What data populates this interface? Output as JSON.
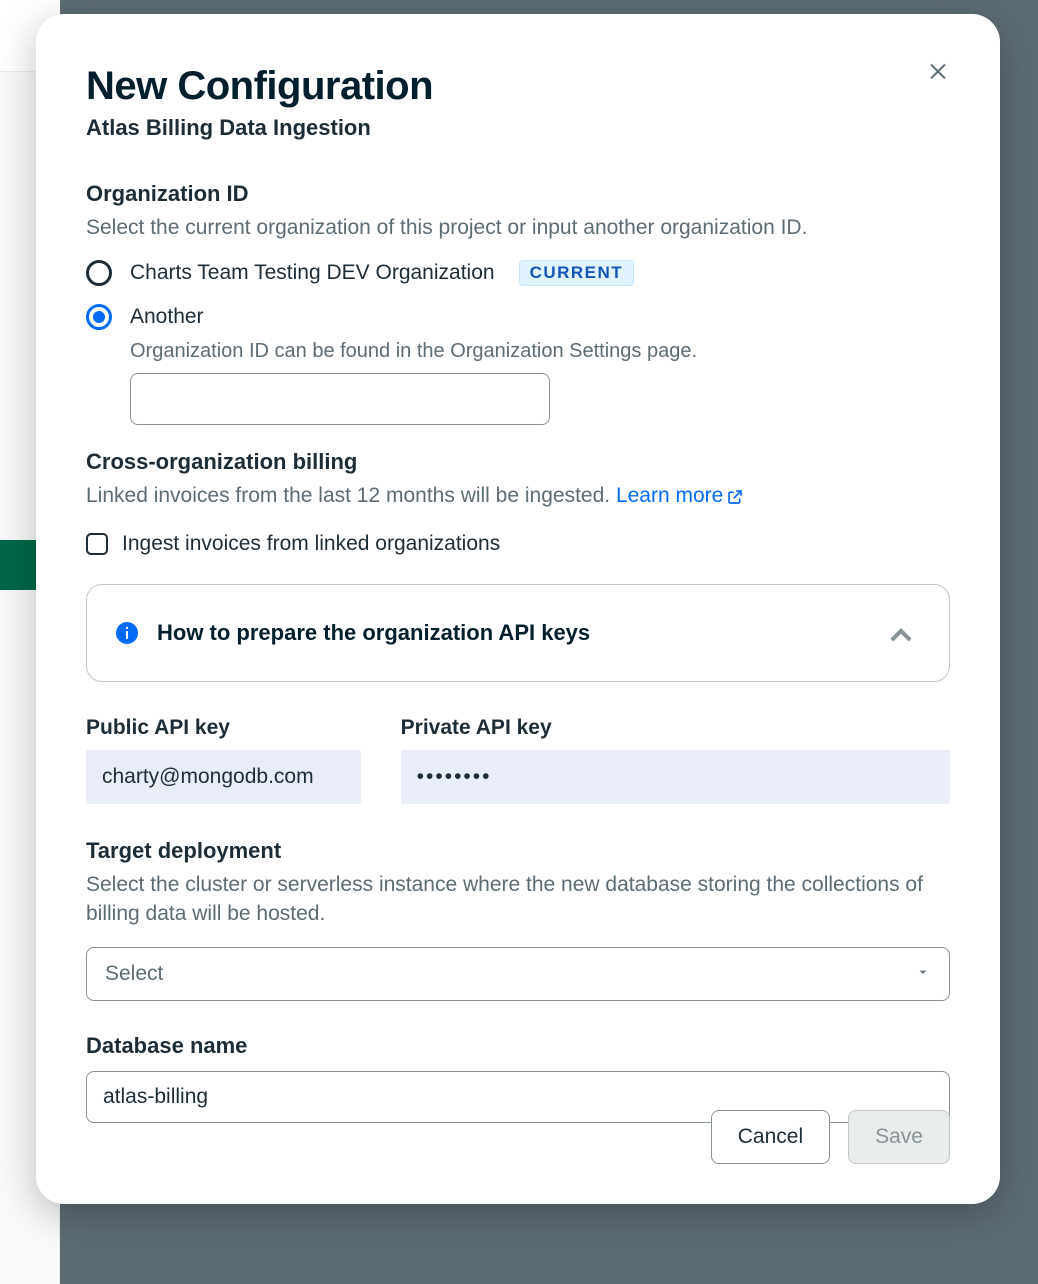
{
  "modal": {
    "title": "New Configuration",
    "subtitle": "Atlas Billing Data Ingestion"
  },
  "org": {
    "label": "Organization ID",
    "desc": "Select the current organization of this project or input another organization ID.",
    "option_current_label": "Charts Team Testing DEV Organization",
    "current_badge": "CURRENT",
    "option_another_label": "Another",
    "another_hint": "Organization ID can be found in the Organization Settings page.",
    "another_value": "",
    "selected": "another"
  },
  "cross": {
    "label": "Cross-organization billing",
    "desc_prefix": "Linked invoices from the last 12 months will be ingested. ",
    "learn_more": "Learn more",
    "checkbox_label": "Ingest invoices from linked organizations",
    "checked": false
  },
  "info_card": {
    "title": "How to prepare the organization API keys",
    "expanded": false
  },
  "api": {
    "public_label": "Public API key",
    "public_value": "charty@mongodb.com",
    "private_label": "Private API key",
    "private_value": "••••••••"
  },
  "target": {
    "label": "Target deployment",
    "desc": "Select the cluster or serverless instance where the new database storing the collections of billing data will be hosted.",
    "placeholder": "Select",
    "value": ""
  },
  "db": {
    "label": "Database name",
    "value": "atlas-billing"
  },
  "footer": {
    "cancel": "Cancel",
    "save": "Save"
  }
}
